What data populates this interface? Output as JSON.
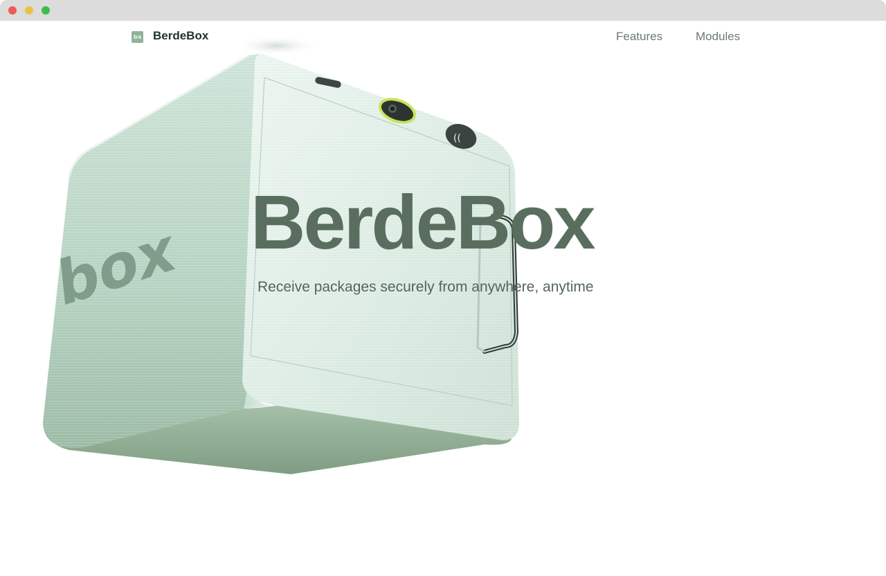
{
  "window": {
    "controls": [
      "close",
      "minimize",
      "maximize"
    ]
  },
  "nav": {
    "logo_text": "b·x",
    "brand": "BerdeBox",
    "links": [
      {
        "label": "Features"
      },
      {
        "label": "Modules"
      }
    ]
  },
  "hero": {
    "title": "BerdeBox",
    "subtitle": "Receive packages securely from anywhere, anytime",
    "product_logo_text": "box"
  },
  "colors": {
    "box_light": "#dff0e8",
    "box_mid": "#b8d6c6",
    "box_dark": "#8fae98",
    "title": "#5a6e60",
    "brand_text": "#1f3328"
  }
}
